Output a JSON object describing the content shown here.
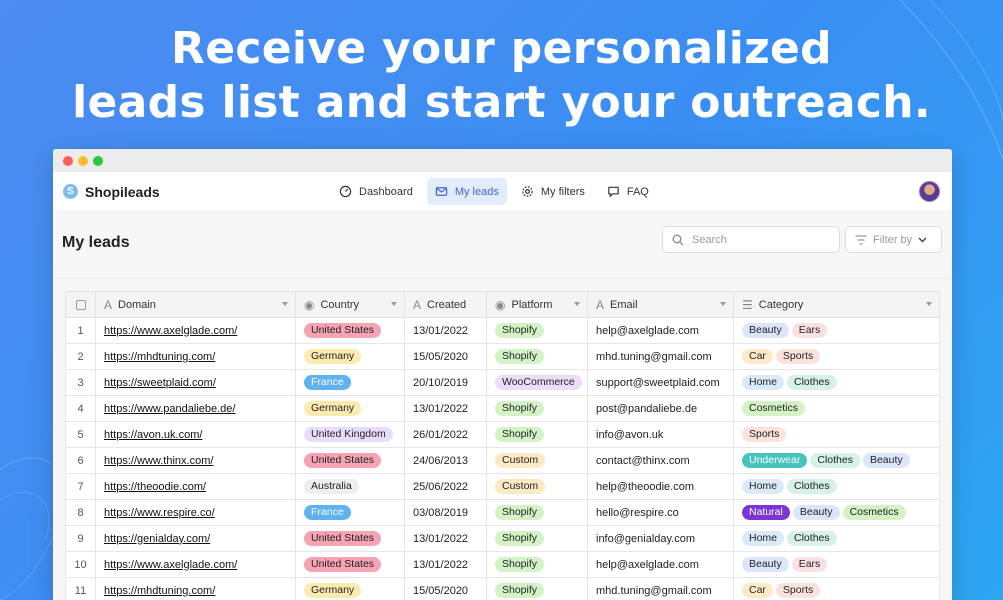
{
  "headline": {
    "line1": "Receive your personalized",
    "line2": "leads list and start your outreach."
  },
  "app": {
    "name": "Shopileads",
    "logo_letter": "S",
    "nav": [
      {
        "label": "Dashboard",
        "icon": "gauge-icon",
        "active": false
      },
      {
        "label": "My leads",
        "icon": "mail-icon",
        "active": true
      },
      {
        "label": "My filters",
        "icon": "gear-icon",
        "active": false
      },
      {
        "label": "FAQ",
        "icon": "chat-icon",
        "active": false
      }
    ]
  },
  "page": {
    "title": "My leads",
    "search_placeholder": "Search",
    "filter_label": "Filter by"
  },
  "table": {
    "columns": [
      "Domain",
      "Country",
      "Created",
      "Platform",
      "Email",
      "Category"
    ],
    "rows": [
      {
        "num": "1",
        "domain": "https://www.axelglade.com/",
        "country": "United States",
        "created": "13/01/2022",
        "platform": "Shopify",
        "email": "help@axelglade.com",
        "categories": [
          "Beauty",
          "Ears"
        ]
      },
      {
        "num": "2",
        "domain": "https://mhdtuning.com/",
        "country": "Germany",
        "created": "15/05/2020",
        "platform": "Shopify",
        "email": "mhd.tuning@gmail.com",
        "categories": [
          "Car",
          "Sports"
        ]
      },
      {
        "num": "3",
        "domain": "https://sweetplaid.com/",
        "country": "France",
        "created": "20/10/2019",
        "platform": "WooCommerce",
        "email": "support@sweetplaid.com",
        "categories": [
          "Home",
          "Clothes"
        ]
      },
      {
        "num": "4",
        "domain": "https://www.pandaliebe.de/",
        "country": "Germany",
        "created": "13/01/2022",
        "platform": "Shopify",
        "email": "post@pandaliebe.de",
        "categories": [
          "Cosmetics"
        ]
      },
      {
        "num": "5",
        "domain": "https://avon.uk.com/",
        "country": "United Kingdom",
        "created": "26/01/2022",
        "platform": "Shopify",
        "email": "info@avon.uk",
        "categories": [
          "Sports"
        ]
      },
      {
        "num": "6",
        "domain": "https://www.thinx.com/",
        "country": "United States",
        "created": "24/06/2013",
        "platform": "Custom",
        "email": "contact@thinx.com",
        "categories": [
          "Underwear",
          "Clothes",
          "Beauty"
        ]
      },
      {
        "num": "7",
        "domain": "https://theoodie.com/",
        "country": "Australia",
        "created": "25/06/2022",
        "platform": "Custom",
        "email": "help@theoodie.com",
        "categories": [
          "Home",
          "Clothes"
        ]
      },
      {
        "num": "8",
        "domain": "https://www.respire.co/",
        "country": "France",
        "created": "03/08/2019",
        "platform": "Shopify",
        "email": "hello@respire.co",
        "categories": [
          "Natural",
          "Beauty",
          "Cosmetics"
        ]
      },
      {
        "num": "9",
        "domain": "https://genialday.com/",
        "country": "United States",
        "created": "13/01/2022",
        "platform": "Shopify",
        "email": "info@genialday.com",
        "categories": [
          "Home",
          "Clothes"
        ]
      },
      {
        "num": "10",
        "domain": "https://www.axelglade.com/",
        "country": "United States",
        "created": "13/01/2022",
        "platform": "Shopify",
        "email": "help@axelglade.com",
        "categories": [
          "Beauty",
          "Ears"
        ]
      },
      {
        "num": "11",
        "domain": "https://mhdtuning.com/",
        "country": "Germany",
        "created": "15/05/2020",
        "platform": "Shopify",
        "email": "mhd.tuning@gmail.com",
        "categories": [
          "Car",
          "Sports"
        ]
      }
    ]
  },
  "tag_colors": {
    "United States": {
      "bg": "#f6a3b4",
      "fg": "#222"
    },
    "Germany": {
      "bg": "#fcebb0",
      "fg": "#222"
    },
    "France": {
      "bg": "#5fb1f0",
      "fg": "#fff"
    },
    "United Kingdom": {
      "bg": "#e8dcfb",
      "fg": "#222"
    },
    "Australia": {
      "bg": "#eeeeee",
      "fg": "#222"
    },
    "Shopify": {
      "bg": "#d3f3c6",
      "fg": "#222"
    },
    "WooCommerce": {
      "bg": "#ecdcf8",
      "fg": "#222"
    },
    "Custom": {
      "bg": "#fde9c2",
      "fg": "#222"
    },
    "Beauty": {
      "bg": "#dde5fb",
      "fg": "#222"
    },
    "Ears": {
      "bg": "#fbe1e3",
      "fg": "#222"
    },
    "Car": {
      "bg": "#fdebc7",
      "fg": "#222"
    },
    "Sports": {
      "bg": "#fbe3dc",
      "fg": "#222"
    },
    "Home": {
      "bg": "#dbeaf9",
      "fg": "#222"
    },
    "Clothes": {
      "bg": "#d6f1e6",
      "fg": "#222"
    },
    "Cosmetics": {
      "bg": "#d3f3c6",
      "fg": "#222"
    },
    "Underwear": {
      "bg": "#45c4bd",
      "fg": "#fff"
    },
    "Natural": {
      "bg": "#7a35d5",
      "fg": "#fff"
    }
  }
}
